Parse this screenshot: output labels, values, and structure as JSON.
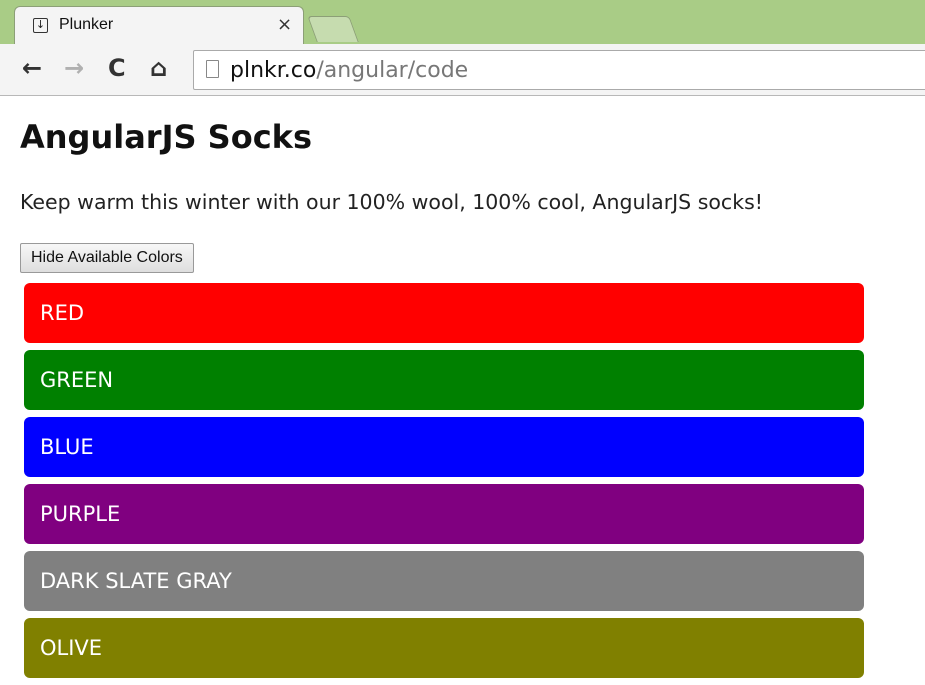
{
  "browser": {
    "tab_title": "Plunker",
    "tab_close": "×",
    "url_host": "plnkr.co",
    "url_path": "/angular/code"
  },
  "page": {
    "title": "AngularJS Socks",
    "description": "Keep warm this winter with our 100% wool, 100% cool, AngularJS socks!",
    "toggle_button": "Hide Available Colors"
  },
  "colors": [
    {
      "label": "RED",
      "color": "#ff0000"
    },
    {
      "label": "GREEN",
      "color": "#008000"
    },
    {
      "label": "BLUE",
      "color": "#0000ff"
    },
    {
      "label": "PURPLE",
      "color": "#800080"
    },
    {
      "label": "DARK SLATE GRAY",
      "color": "#808080"
    },
    {
      "label": "OLIVE",
      "color": "#808000"
    }
  ]
}
